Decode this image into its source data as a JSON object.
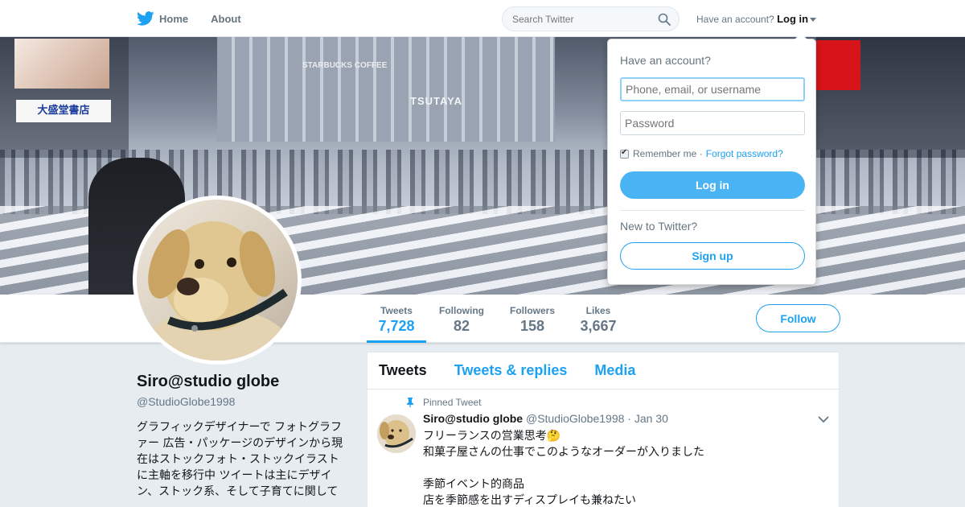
{
  "nav": {
    "home_label": "Home",
    "about_label": "About",
    "search_placeholder": "Search Twitter",
    "have_account": "Have an account?",
    "login_label": "Log in"
  },
  "banner": {
    "signs": [
      "大盛堂書店",
      "TSUTAYA",
      "STARBUCKS COFFEE"
    ]
  },
  "stats": [
    {
      "label": "Tweets",
      "value": "7,728"
    },
    {
      "label": "Following",
      "value": "82"
    },
    {
      "label": "Followers",
      "value": "158"
    },
    {
      "label": "Likes",
      "value": "3,667"
    }
  ],
  "follow_label": "Follow",
  "profile": {
    "name": "Siro@studio globe",
    "handle": "@StudioGlobe1998",
    "bio": "グラフィックデザイナーで フォトグラファー 広告・パッケージのデザインから現在はストックフォト・ストックイラストに主軸を移行中 ツイートは主にデザイン、ストック系、そして子育てに関して"
  },
  "timeline": {
    "tabs": [
      "Tweets",
      "Tweets & replies",
      "Media"
    ],
    "pinned_label": "Pinned Tweet",
    "tweet": {
      "name": "Siro@studio globe",
      "handle": "@StudioGlobe1998",
      "date": "· Jan 30",
      "lines": [
        "フリーランスの営業思考🤔",
        "和菓子屋さんの仕事でこのようなオーダーが入りました",
        "",
        "季節イベント的商品",
        "店を季節感を出すディスプレイも兼ねたい"
      ]
    }
  },
  "login": {
    "title": "Have an account?",
    "username_placeholder": "Phone, email, or username",
    "password_placeholder": "Password",
    "remember": "Remember me",
    "separator": "·",
    "forgot": "Forgot password?",
    "login_button": "Log in",
    "new_label": "New to Twitter?",
    "signup_button": "Sign up"
  },
  "colors": {
    "accent": "#1da1f2",
    "login_button": "#4ab3f4",
    "background": "#e6ecf0"
  }
}
